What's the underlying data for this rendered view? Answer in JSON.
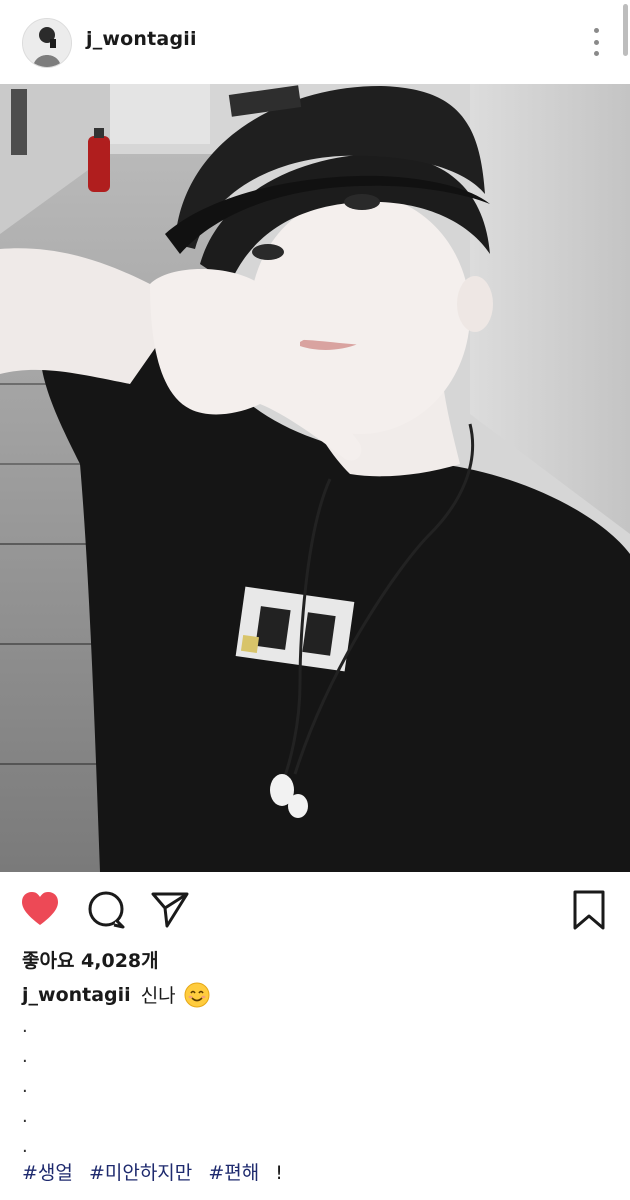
{
  "post": {
    "username": "j_wontagii",
    "likes_text": "좋아요 4,028개",
    "caption_text": "신나",
    "caption_emoji": "smiling-face-emoji",
    "caption_dots": [
      ".",
      ".",
      ".",
      ".",
      "."
    ],
    "hashtags": [
      "#생얼",
      "#미안하지만",
      "#편해"
    ],
    "hashtag_suffix": "!"
  },
  "icons": {
    "more": "more-vertical-icon",
    "like": "heart-icon",
    "comment": "comment-icon",
    "share": "send-icon",
    "save": "bookmark-icon"
  },
  "colors": {
    "like_active": "#ED4956",
    "hashtag": "#1E2A6E"
  }
}
